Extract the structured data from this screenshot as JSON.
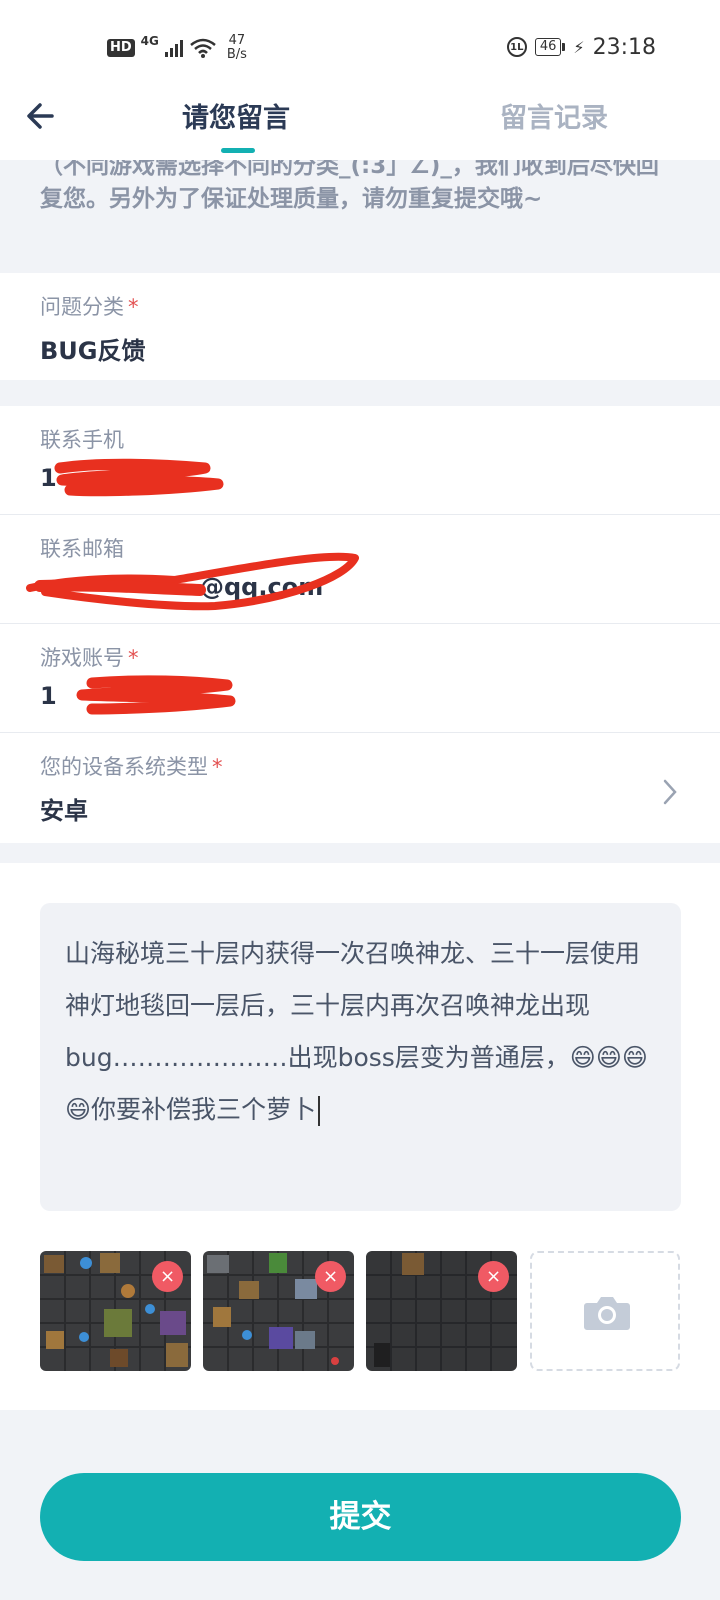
{
  "status_bar": {
    "hd_label": "HD",
    "network_type": "4G",
    "speed_value": "47",
    "speed_unit": "B/s",
    "hd_voice_label": "1L",
    "battery_level": "46",
    "time": "23:18"
  },
  "header": {
    "tab_active": "请您留言",
    "tab_inactive": "留言记录",
    "accent_color": "#13b0b2"
  },
  "notice": {
    "text": "（不同游戏需选择不同的分类_(:3」∠)_，我们收到后尽快回复您。另外为了保证处理质量，请勿重复提交哦~"
  },
  "form": {
    "category_label": "问题分类",
    "category_value": "BUG反馈",
    "phone_label": "联系手机",
    "phone_value": "1",
    "email_label": "联系邮箱",
    "email_value": "@qq.com",
    "account_label": "游戏账号",
    "account_value": "1",
    "device_label": "您的设备系统类型",
    "device_value": "安卓",
    "required_mark": "*"
  },
  "message": {
    "text": "山海秘境三十层内获得一次召唤神龙、三十一层使用神灯地毯回一层后，三十层内再次召唤神龙出现bug…………………出现boss层变为普通层，😄😄😄😄你要补偿我三个萝卜"
  },
  "attachments": {
    "remove_symbol": "×"
  },
  "submit": {
    "label": "提交"
  }
}
